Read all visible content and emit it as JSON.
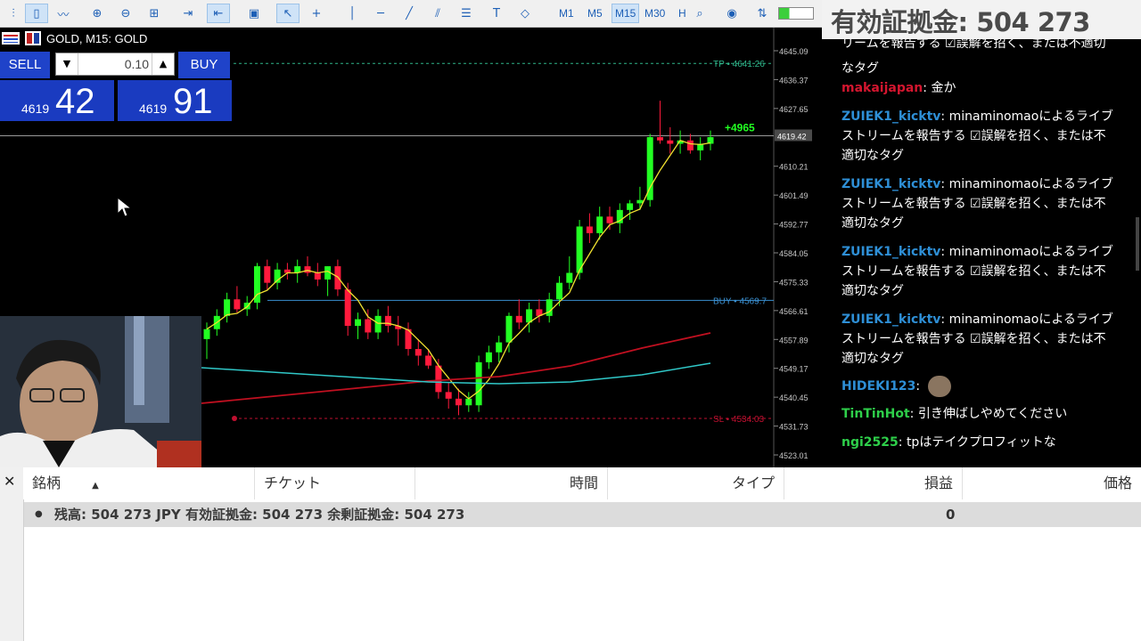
{
  "toolbar": {
    "timeframes": [
      {
        "label": "M1",
        "active": false
      },
      {
        "label": "M5",
        "active": false
      },
      {
        "label": "M15",
        "active": true
      },
      {
        "label": "M30",
        "active": false
      },
      {
        "label": "H",
        "active": false
      }
    ],
    "icons": [
      "chart-bars-icon",
      "candles-icon",
      "line-chart-icon",
      "zoom-in-icon",
      "zoom-out-icon",
      "grid-icon",
      "autoscroll-icon",
      "chart-shift-icon",
      "screenshot-icon",
      "cursor-icon",
      "crosshair-icon",
      "vertical-line-icon",
      "horizontal-line-icon",
      "trendline-icon",
      "channel-icon",
      "fibonacci-icon",
      "text-icon",
      "shapes-icon",
      "search-icon",
      "account-icon",
      "signal-icon",
      "connection-bar-icon"
    ]
  },
  "balance_banner": "有効証拠金: 504 273",
  "chart": {
    "title": "GOLD, M15:  GOLD",
    "one_click": {
      "sell_label": "SELL",
      "buy_label": "BUY",
      "lot": "0.10",
      "bid_prefix": "4619",
      "bid_big": "42",
      "ask_prefix": "4619",
      "ask_big": "91"
    },
    "tp_label": "TP • 4641.26",
    "buy_label": "BUY • 4569.7",
    "sl_label": "SL • 4534.03",
    "profit_label": "+4965",
    "current_price_tag": "4619.42",
    "colors": {
      "bull": "#22ff22",
      "bear": "#ff1a3c",
      "ma_fast": "#f0e030",
      "ma_mid": "#c01020",
      "ma_slow": "#30c8c8",
      "tp": "#2fb58a",
      "buy_line": "#3a8fd0",
      "sl": "#c01030"
    }
  },
  "chart_data": {
    "type": "candlestick",
    "title": "GOLD, M15: GOLD",
    "y_ticks": [
      "4645.09",
      "4636.37",
      "4627.65",
      "4619.42",
      "4610.21",
      "4601.49",
      "4592.77",
      "4584.05",
      "4575.33",
      "4566.61",
      "4557.89",
      "4549.17",
      "4540.45",
      "4531.73",
      "4523.01"
    ],
    "levels": {
      "tp": 4641.26,
      "buy": 4569.7,
      "sl": 4534.03,
      "current": 4619.42
    },
    "candles": [
      {
        "o": 4558,
        "h": 4563,
        "l": 4552,
        "c": 4561
      },
      {
        "o": 4561,
        "h": 4567,
        "l": 4559,
        "c": 4565
      },
      {
        "o": 4565,
        "h": 4572,
        "l": 4563,
        "c": 4570
      },
      {
        "o": 4570,
        "h": 4574,
        "l": 4566,
        "c": 4567
      },
      {
        "o": 4567,
        "h": 4571,
        "l": 4565,
        "c": 4569
      },
      {
        "o": 4569,
        "h": 4581,
        "l": 4567,
        "c": 4580
      },
      {
        "o": 4580,
        "h": 4582,
        "l": 4573,
        "c": 4575
      },
      {
        "o": 4575,
        "h": 4581,
        "l": 4573,
        "c": 4579
      },
      {
        "o": 4579,
        "h": 4581,
        "l": 4576,
        "c": 4578
      },
      {
        "o": 4578,
        "h": 4582,
        "l": 4575,
        "c": 4580
      },
      {
        "o": 4580,
        "h": 4583,
        "l": 4577,
        "c": 4578
      },
      {
        "o": 4578,
        "h": 4581,
        "l": 4574,
        "c": 4576
      },
      {
        "o": 4576,
        "h": 4580,
        "l": 4571,
        "c": 4580
      },
      {
        "o": 4580,
        "h": 4582,
        "l": 4571,
        "c": 4573
      },
      {
        "o": 4573,
        "h": 4575,
        "l": 4559,
        "c": 4562
      },
      {
        "o": 4562,
        "h": 4566,
        "l": 4558,
        "c": 4564
      },
      {
        "o": 4564,
        "h": 4567,
        "l": 4558,
        "c": 4560
      },
      {
        "o": 4560,
        "h": 4567,
        "l": 4558,
        "c": 4565
      },
      {
        "o": 4565,
        "h": 4568,
        "l": 4560,
        "c": 4562
      },
      {
        "o": 4562,
        "h": 4565,
        "l": 4556,
        "c": 4561
      },
      {
        "o": 4561,
        "h": 4563,
        "l": 4553,
        "c": 4555
      },
      {
        "o": 4555,
        "h": 4558,
        "l": 4550,
        "c": 4553
      },
      {
        "o": 4553,
        "h": 4555,
        "l": 4549,
        "c": 4550
      },
      {
        "o": 4550,
        "h": 4552,
        "l": 4540,
        "c": 4542
      },
      {
        "o": 4542,
        "h": 4545,
        "l": 4537,
        "c": 4540
      },
      {
        "o": 4540,
        "h": 4543,
        "l": 4535,
        "c": 4538
      },
      {
        "o": 4538,
        "h": 4542,
        "l": 4536,
        "c": 4540
      },
      {
        "o": 4538,
        "h": 4553,
        "l": 4536,
        "c": 4551
      },
      {
        "o": 4551,
        "h": 4556,
        "l": 4549,
        "c": 4554
      },
      {
        "o": 4554,
        "h": 4559,
        "l": 4551,
        "c": 4557
      },
      {
        "o": 4557,
        "h": 4566,
        "l": 4554,
        "c": 4565
      },
      {
        "o": 4565,
        "h": 4570,
        "l": 4561,
        "c": 4563
      },
      {
        "o": 4563,
        "h": 4569,
        "l": 4560,
        "c": 4567
      },
      {
        "o": 4567,
        "h": 4570,
        "l": 4563,
        "c": 4565
      },
      {
        "o": 4565,
        "h": 4572,
        "l": 4563,
        "c": 4570
      },
      {
        "o": 4570,
        "h": 4577,
        "l": 4568,
        "c": 4575
      },
      {
        "o": 4575,
        "h": 4583,
        "l": 4573,
        "c": 4578
      },
      {
        "o": 4578,
        "h": 4594,
        "l": 4576,
        "c": 4592
      },
      {
        "o": 4592,
        "h": 4596,
        "l": 4587,
        "c": 4590
      },
      {
        "o": 4590,
        "h": 4598,
        "l": 4588,
        "c": 4595
      },
      {
        "o": 4595,
        "h": 4598,
        "l": 4591,
        "c": 4593
      },
      {
        "o": 4593,
        "h": 4599,
        "l": 4590,
        "c": 4597
      },
      {
        "o": 4597,
        "h": 4600,
        "l": 4594,
        "c": 4599
      },
      {
        "o": 4599,
        "h": 4604,
        "l": 4597,
        "c": 4600
      },
      {
        "o": 4600,
        "h": 4620,
        "l": 4598,
        "c": 4619
      },
      {
        "o": 4619,
        "h": 4630,
        "l": 4617,
        "c": 4618
      },
      {
        "o": 4618,
        "h": 4622,
        "l": 4614,
        "c": 4617
      },
      {
        "o": 4617,
        "h": 4621,
        "l": 4614,
        "c": 4618
      },
      {
        "o": 4618,
        "h": 4620,
        "l": 4614,
        "c": 4615
      },
      {
        "o": 4615,
        "h": 4619,
        "l": 4612,
        "c": 4617
      },
      {
        "o": 4617,
        "h": 4621,
        "l": 4615,
        "c": 4619
      }
    ]
  },
  "chat": {
    "messages": [
      {
        "user": "",
        "user_color": "#2e8fd6",
        "text": "リームを報告する  ☑誤解を招く、または不適切"
      },
      {
        "user": "",
        "user_color": "#2e8fd6",
        "text": "なタグ"
      },
      {
        "user": "makaijapan",
        "user_color": "#d4162f",
        "text": "金か"
      },
      {
        "user": "ZUIEK1_kicktv",
        "user_color": "#2e8fd6",
        "text": "minaminomaoによるライブストリームを報告する  ☑誤解を招く、または不適切なタグ"
      },
      {
        "user": "ZUIEK1_kicktv",
        "user_color": "#2e8fd6",
        "text": "minaminomaoによるライブストリームを報告する  ☑誤解を招く、または不適切なタグ"
      },
      {
        "user": "ZUIEK1_kicktv",
        "user_color": "#2e8fd6",
        "text": "minaminomaoによるライブストリームを報告する  ☑誤解を招く、または不適切なタグ"
      },
      {
        "user": "ZUIEK1_kicktv",
        "user_color": "#2e8fd6",
        "text": "minaminomaoによるライブストリームを報告する  ☑誤解を招く、または不適切なタグ"
      },
      {
        "user": "HIDEKI123",
        "user_color": "#2e8fd6",
        "text": ""
      },
      {
        "user": "TinTinHot",
        "user_color": "#2ecf4a",
        "text": "引き伸ばしやめてください"
      },
      {
        "user": "ngi2525",
        "user_color": "#2ecf4a",
        "text": "tpはテイクプロフィットな"
      }
    ]
  },
  "terminal": {
    "columns": [
      "銘柄",
      "チケット",
      "時間",
      "タイプ",
      "損益",
      "価格"
    ],
    "summary": "残高: 504 273 JPY  有効証拠金: 504 273  余剰証拠金: 504 273",
    "summary_profit": "0"
  }
}
